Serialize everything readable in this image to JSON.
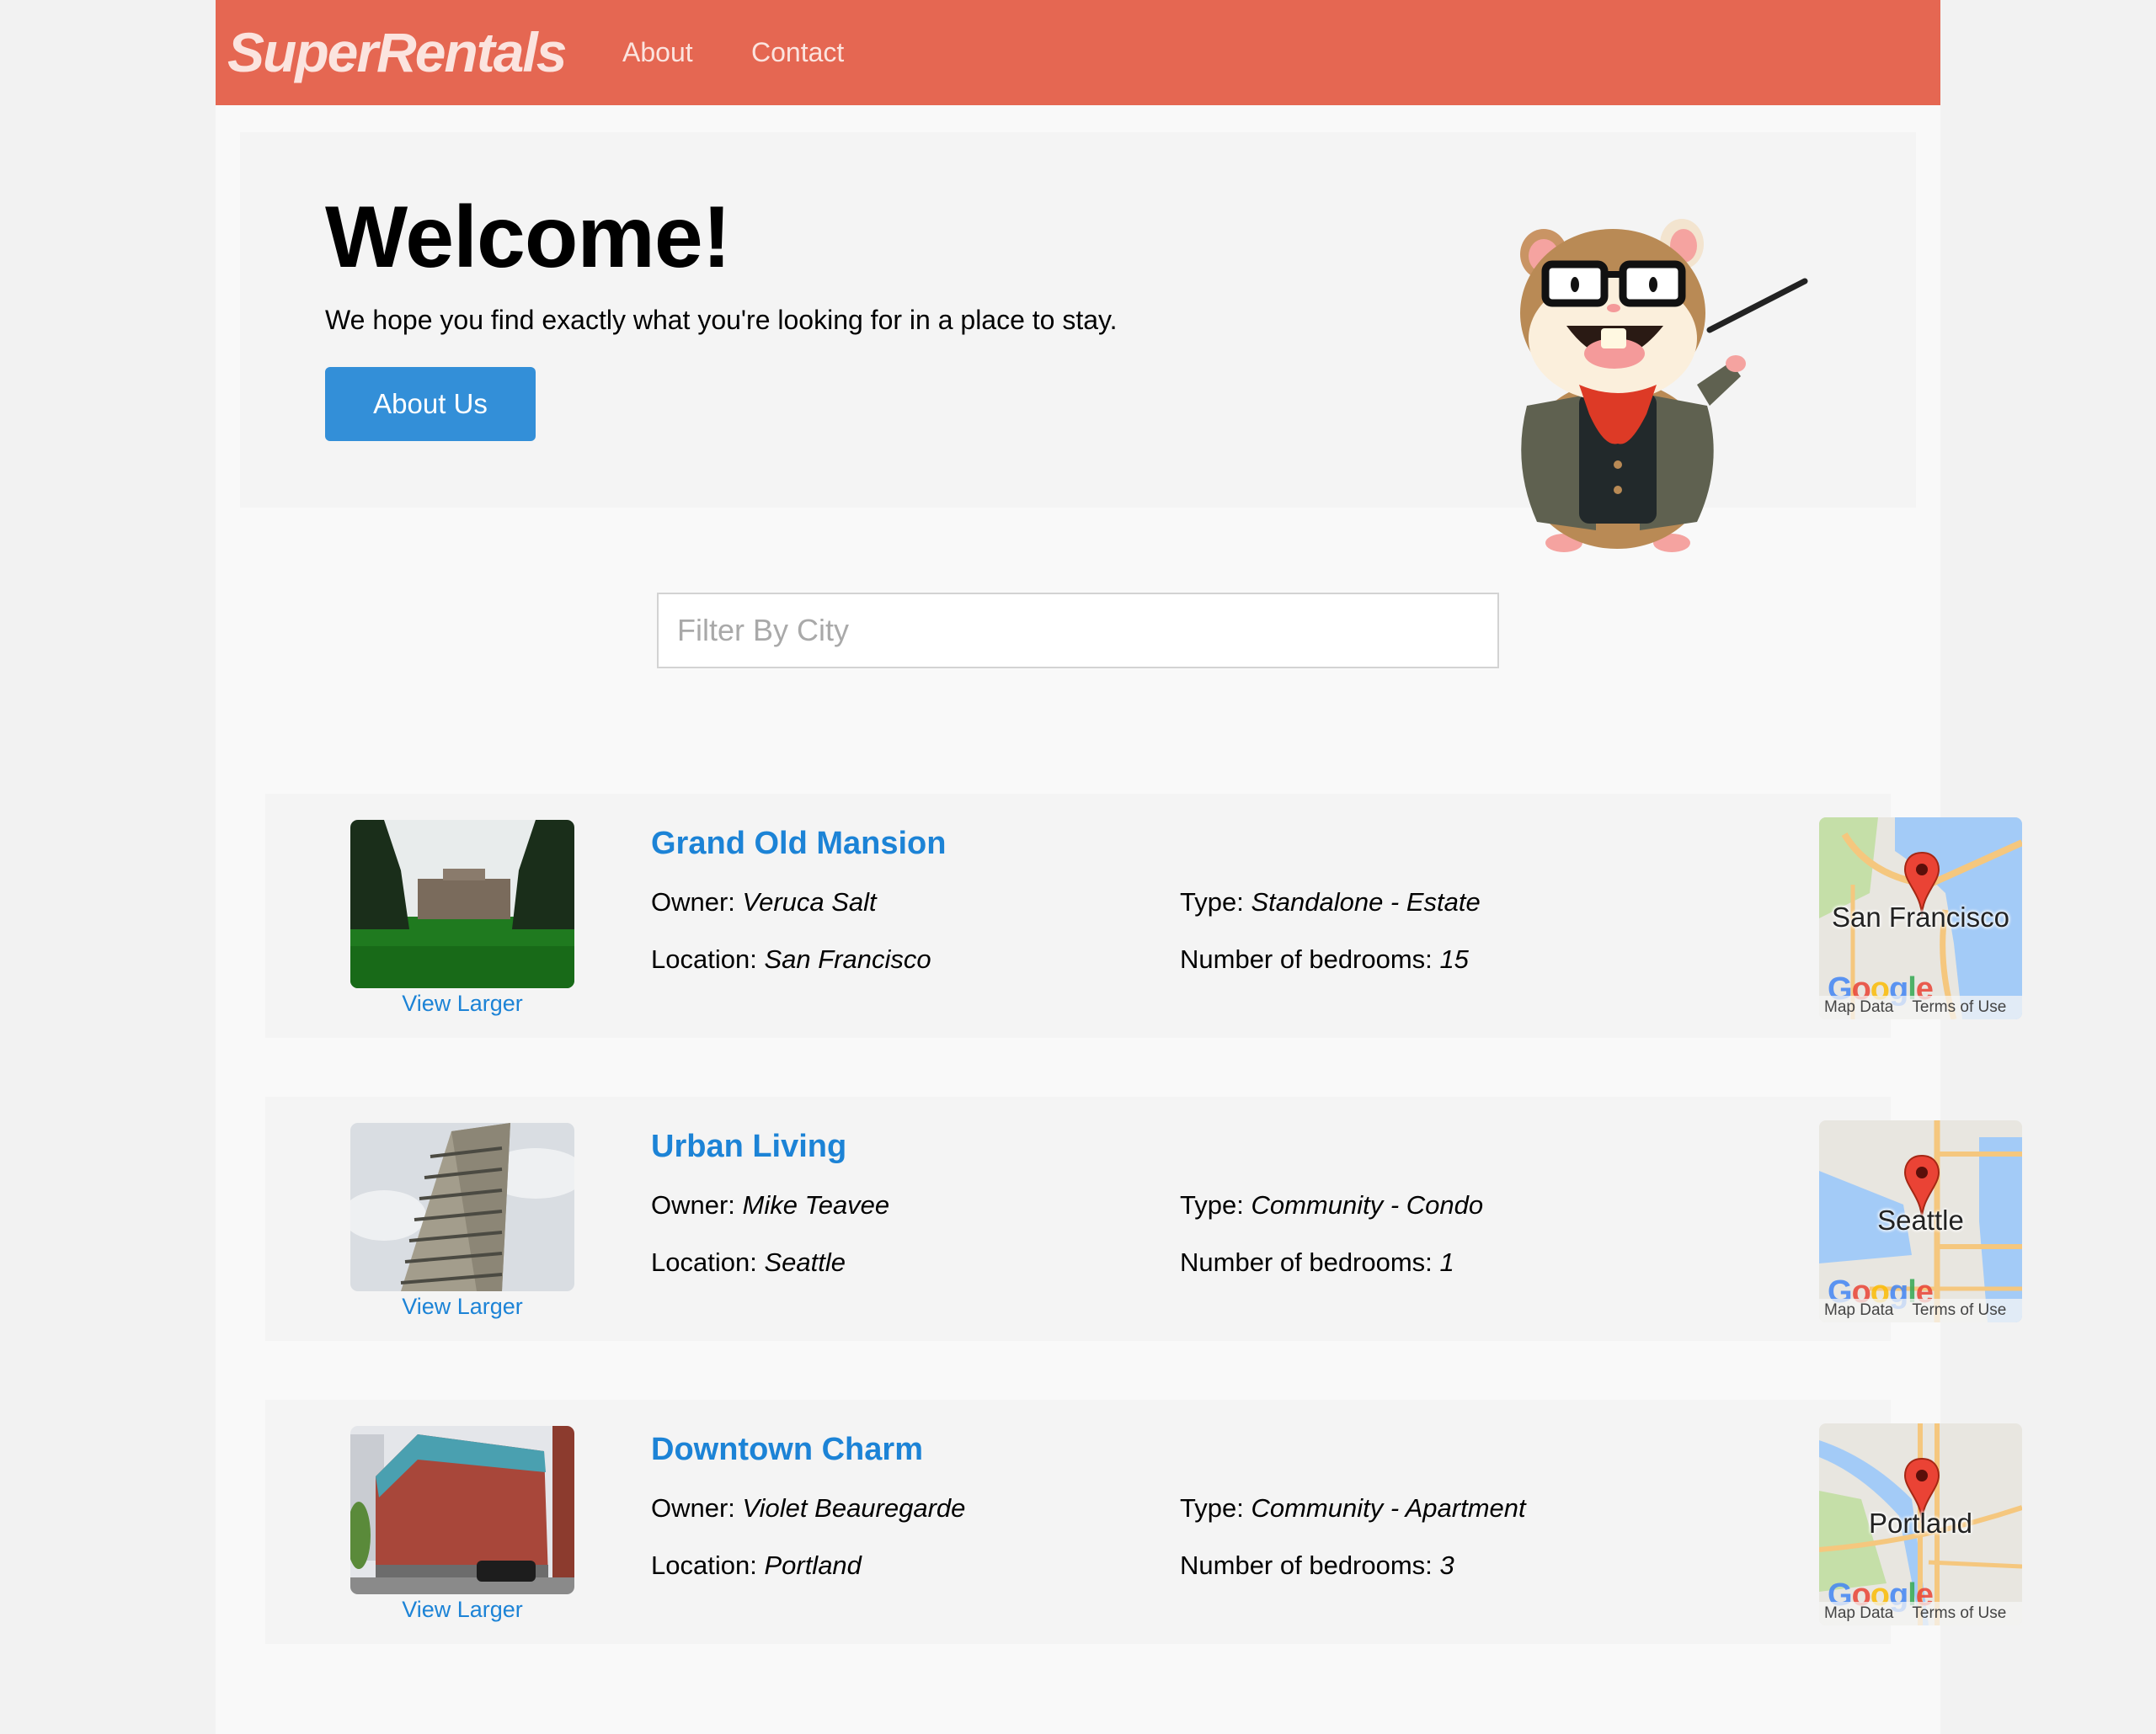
{
  "nav": {
    "logo": "SuperRentals",
    "links": [
      {
        "label": "About"
      },
      {
        "label": "Contact"
      }
    ],
    "color": "#e56752"
  },
  "jumbo": {
    "title": "Welcome!",
    "subtitle": "We hope you find exactly what you're looking for in a place to stay.",
    "button_label": "About Us",
    "mascot": "tomster-hamster-with-glasses-and-pointer"
  },
  "filter": {
    "placeholder": "Filter By City",
    "value": ""
  },
  "labels": {
    "owner": "Owner:",
    "location": "Location:",
    "type": "Type:",
    "bedrooms": "Number of bedrooms:",
    "view_larger": "View Larger",
    "map_data": "Map Data",
    "terms": "Terms of Use",
    "google": "Google"
  },
  "rentals": [
    {
      "title": "Grand Old Mansion",
      "owner": "Veruca Salt",
      "location": "San Francisco",
      "type": "Standalone - Estate",
      "bedrooms": "15",
      "map_city": "San Francisco",
      "image": "mansion-photo"
    },
    {
      "title": "Urban Living",
      "owner": "Mike Teavee",
      "location": "Seattle",
      "type": "Community - Condo",
      "bedrooms": "1",
      "map_city": "Seattle",
      "image": "condo-tower-photo"
    },
    {
      "title": "Downtown Charm",
      "owner": "Violet Beauregarde",
      "location": "Portland",
      "type": "Community - Apartment",
      "bedrooms": "3",
      "map_city": "Portland",
      "image": "apartment-building-photo"
    }
  ]
}
